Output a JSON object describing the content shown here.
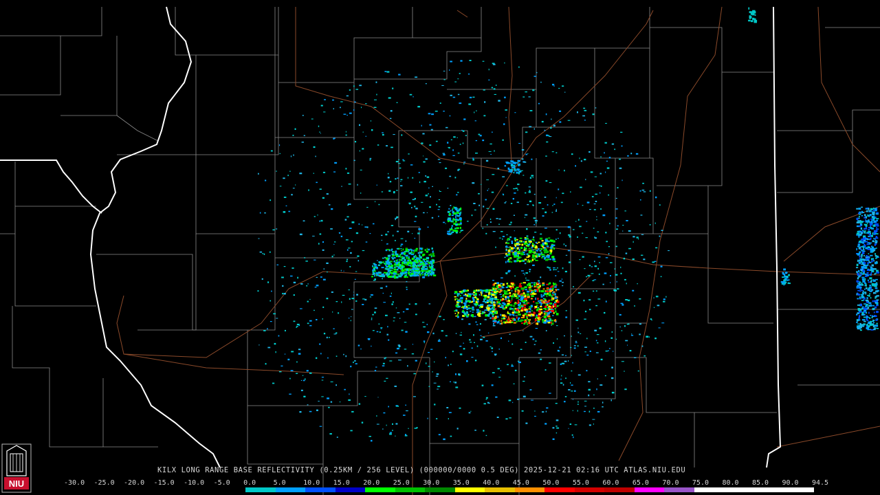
{
  "product": {
    "caption": "KILX LONG RANGE BASE REFLECTIVITY (0.25KM / 256 LEVEL) (000000/0000 0.5 DEG) 2025-12-21 02:16 UTC  ATLAS.NIU.EDU"
  },
  "legend": {
    "ticks": [
      "-30.0",
      "-25.0",
      "-20.0",
      "-15.0",
      "-10.0",
      "-5.0",
      "0.0",
      "5.0",
      "10.0",
      "15.0",
      "20.0",
      "25.0",
      "30.0",
      "35.0",
      "40.0",
      "45.0",
      "50.0",
      "55.0",
      "60.0",
      "65.0",
      "70.0",
      "75.0",
      "80.0",
      "85.0",
      "90.0",
      "94.5"
    ],
    "colors": [
      "#000000",
      "#000000",
      "#000000",
      "#000000",
      "#000000",
      "#000000",
      "#00c8c8",
      "#00a0ff",
      "#0050ff",
      "#0000c8",
      "#00ff00",
      "#00c000",
      "#008800",
      "#ffff00",
      "#e8c000",
      "#ff9000",
      "#ff0000",
      "#d40000",
      "#c00000",
      "#ff00ff",
      "#9955c9",
      "#ffffff",
      "#ffffff",
      "#ffffff",
      "#ffffff"
    ]
  },
  "logo": {
    "text": "NIU",
    "color": "#c8102e"
  }
}
